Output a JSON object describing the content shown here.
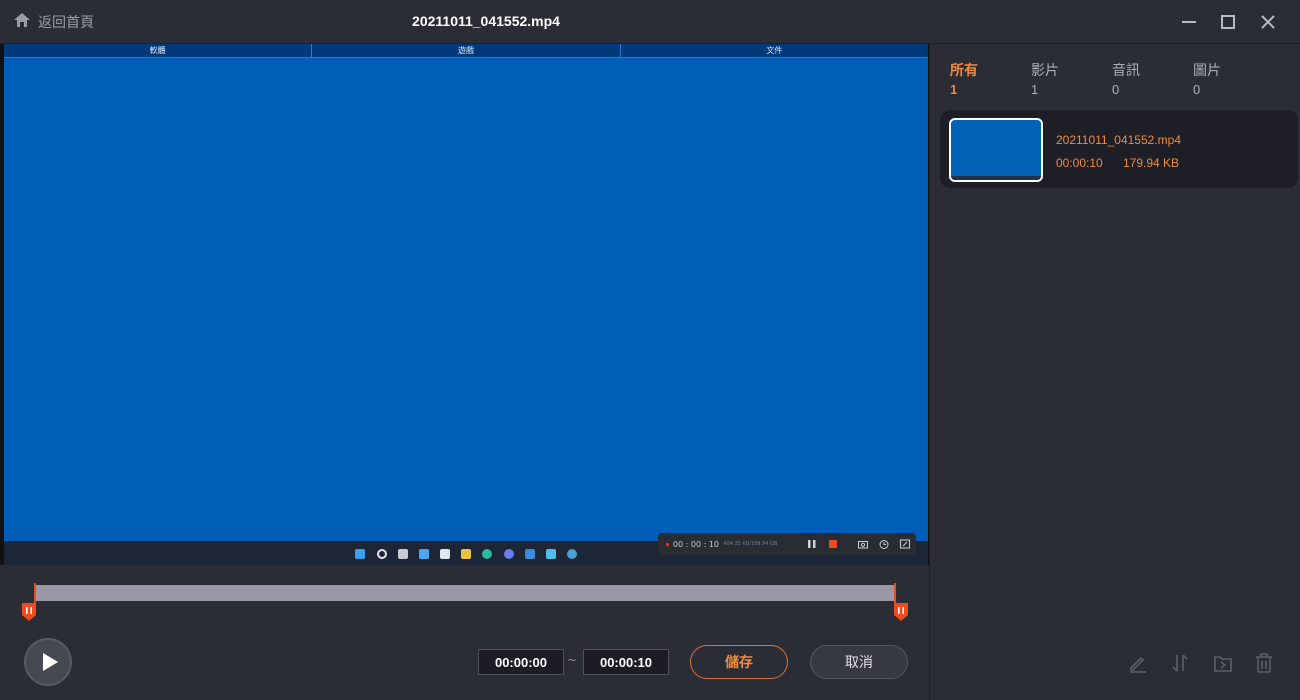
{
  "titlebar": {
    "home_label": "返回首頁",
    "file_title": "20211011_041552.mp4",
    "icons": [
      "home-icon",
      "minimize-icon",
      "maximize-icon",
      "close-icon"
    ]
  },
  "video": {
    "screen_tabs": [
      "軟體",
      "遊戲",
      "文件"
    ],
    "recorder_time": "00 : 00 : 10",
    "recorder_size": "404.35 KB/189.94 GB",
    "recorder_icons": [
      "pause-icon",
      "stop-icon",
      "camera-icon",
      "timer-icon",
      "crop-icon"
    ],
    "colors": {
      "screen": "#005eb8",
      "accent": "#f04a1e"
    }
  },
  "trim": {
    "start_time": "00:00:00",
    "separator": "~",
    "end_time": "00:00:10",
    "save_label": "儲存",
    "cancel_label": "取消"
  },
  "sidebar": {
    "filters": [
      {
        "label": "所有",
        "count": "1"
      },
      {
        "label": "影片",
        "count": "1"
      },
      {
        "label": "音訊",
        "count": "0"
      },
      {
        "label": "圖片",
        "count": "0"
      }
    ],
    "files": [
      {
        "name": "20211011_041552.mp4",
        "duration": "00:00:10",
        "size": "179.94 KB"
      }
    ],
    "tools": [
      "edit-icon",
      "convert-icon",
      "export-icon",
      "delete-icon"
    ]
  }
}
